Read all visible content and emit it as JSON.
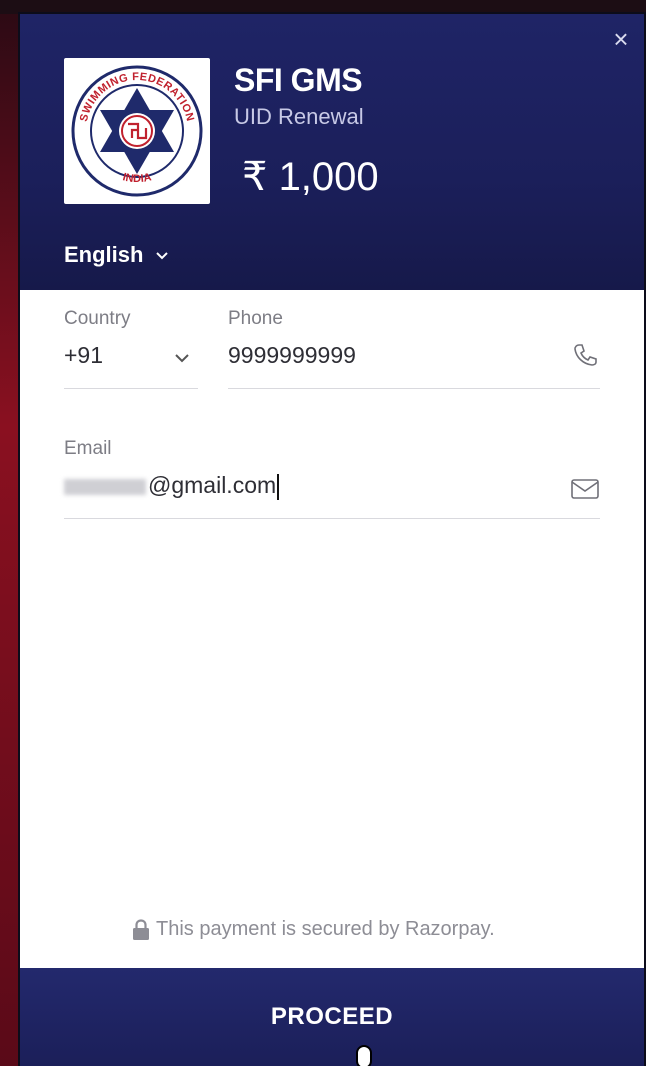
{
  "header": {
    "merchant_name": "SFI GMS",
    "description": "UID Renewal",
    "amount": "₹ 1,000",
    "language": "English",
    "close_symbol": "×",
    "logo": {
      "top_text": "SWIMMING FEDERATION",
      "bottom_text": "INDIA",
      "icon": "swimming-federation-logo"
    }
  },
  "form": {
    "country": {
      "label": "Country",
      "value": "+91"
    },
    "phone": {
      "label": "Phone",
      "value": "9999999999",
      "icon": "phone-icon"
    },
    "email": {
      "label": "Email",
      "value": "@gmail.com",
      "icon": "mail-icon"
    }
  },
  "footer": {
    "secure_text": "This payment is secured by Razorpay.",
    "proceed_label": "PROCEED"
  },
  "colors": {
    "header_bg": "#1f2466",
    "accent_text": "#ffffff",
    "muted_text": "#7d7d85"
  }
}
